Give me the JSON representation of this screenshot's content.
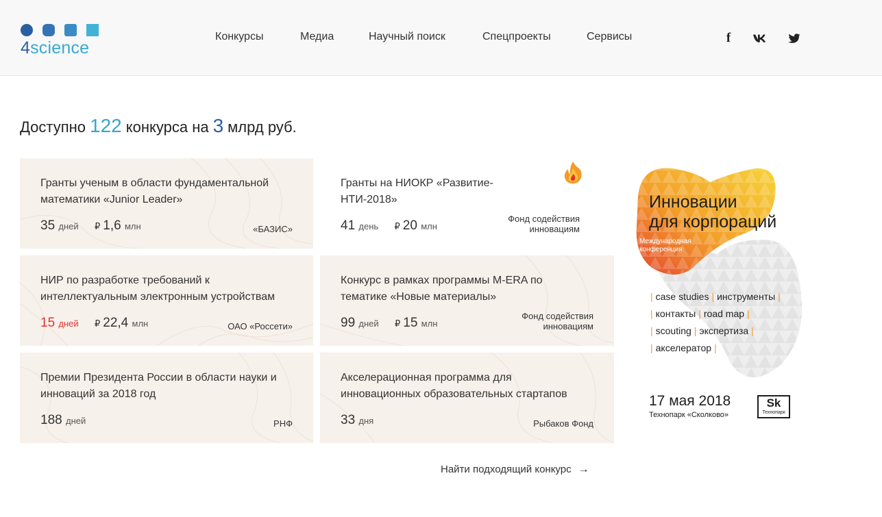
{
  "logo": {
    "word_four": "4",
    "word_science": "science",
    "squares": [
      "#2b5fa3",
      "#3574b4",
      "#3a8cc6",
      "#42b3d6"
    ]
  },
  "nav": {
    "items": [
      {
        "label": "Конкурсы"
      },
      {
        "label": "Медиа"
      },
      {
        "label": "Научный поиск"
      },
      {
        "label": "Спецпроекты"
      },
      {
        "label": "Сервисы"
      }
    ]
  },
  "social": {
    "facebook": "f",
    "vk": "vk",
    "twitter": "twitter-icon"
  },
  "headline": {
    "prefix": "Доступно",
    "count": "122",
    "middle": "конкурса на",
    "amount": "3",
    "suffix": "млрд руб."
  },
  "cards": [
    {
      "title": "Гранты ученым в области фундаментальной математики «Junior Leader»",
      "days": "35",
      "days_unit": "дней",
      "currency": "₽",
      "amount": "1,6",
      "amount_unit": "млн",
      "org": "«БАЗИС»",
      "urgent": false
    },
    {
      "title": "Гранты на НИОКР «Развитие-НТИ-2018»",
      "days": "41",
      "days_unit": "день",
      "currency": "₽",
      "amount": "20",
      "amount_unit": "млн",
      "org_line1": "Фонд содействия",
      "org_line2": "инновациям",
      "urgent": false,
      "hot": true
    },
    {
      "title": "НИР по разработке требований к интеллектуальным электронным устройствам",
      "days": "15",
      "days_unit": "дней",
      "currency": "₽",
      "amount": "22,4",
      "amount_unit": "млн",
      "org": "ОАО «Россети»",
      "urgent": true
    },
    {
      "title": "Конкурс в рамках программы M-ERA по тематике «Новые материалы»",
      "days": "99",
      "days_unit": "дней",
      "currency": "₽",
      "amount": "15",
      "amount_unit": "млн",
      "org_line1": "Фонд содействия",
      "org_line2": "инновациям",
      "urgent": false
    },
    {
      "title": "Премии Президента России в области науки и инноваций за 2018 год",
      "days": "188",
      "days_unit": "дней",
      "org": "РНФ",
      "urgent": false
    },
    {
      "title": "Акселерационная программа для инновационных образовательных стартапов",
      "days": "33",
      "days_unit": "дня",
      "org": "Рыбаков Фонд",
      "urgent": false
    }
  ],
  "find_link": {
    "label": "Найти подходящий конкурс",
    "arrow": "→"
  },
  "banner": {
    "title_line1": "Инновации",
    "title_line2": "для корпораций",
    "subtitle_line1": "Международная",
    "subtitle_line2": "конференция",
    "tags_row1": [
      "case studies",
      "инструменты"
    ],
    "tags_row2": [
      "контакты",
      "road map"
    ],
    "tags_row3": [
      "scouting",
      "экспертиза"
    ],
    "tags_row4": [
      "акселератор"
    ],
    "date": "17 мая 2018",
    "place": "Технопарк «Сколково»",
    "sk_logo": "Sk",
    "sk_logo_sub": "Технопарк",
    "colors": {
      "orange": "#f3a02a",
      "red": "#e5472f",
      "yellow": "#f6d33a",
      "grey": "#eaeaea"
    }
  },
  "colors": {
    "accent_light": "#35a6cc",
    "accent_dark": "#2b5fa3",
    "urgent": "#e5322d",
    "card_bg": "#f7f1eb"
  }
}
